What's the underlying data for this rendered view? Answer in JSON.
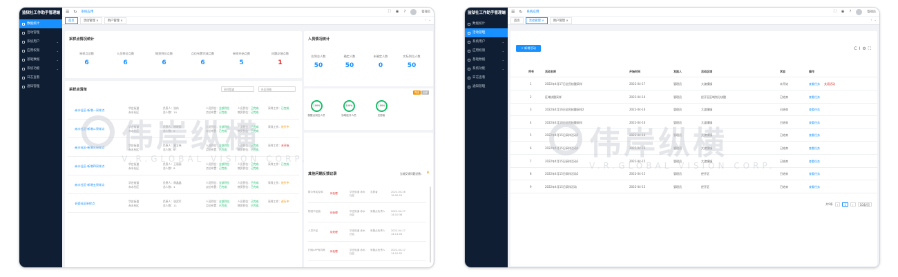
{
  "brand": "监狱社工作助手管理端",
  "watermark": {
    "cn": "伟岸纵横",
    "en": "V.R.GLOBAL VISION CORP."
  },
  "left": {
    "menu": [
      "数据统计",
      "活动管理",
      "系统用户",
      "应用权限",
      "基础数据",
      "系统功能",
      "日志查看",
      "通知管理"
    ],
    "active_index": 0,
    "topbar": {
      "breadcrumb": "系统应用",
      "user": "管理员"
    },
    "tabs": [
      "首页",
      "活动管理 ×",
      "用户管理 ×"
    ],
    "samples": {
      "title": "采样点情况统计",
      "stats": [
        {
          "label": "采样点总数",
          "value": "6"
        },
        {
          "label": "人员到位点数",
          "value": "6"
        },
        {
          "label": "物资到位点数",
          "value": "6"
        },
        {
          "label": "点位布置完成点数",
          "value": "6"
        },
        {
          "label": "采样开始点数",
          "value": "5"
        },
        {
          "label": "问题反馈点数",
          "value": "1"
        }
      ]
    },
    "people": {
      "title": "人员情况统计",
      "stats": [
        {
          "label": "应到总人数",
          "value": "50"
        },
        {
          "label": "确定人数",
          "value": "50"
        },
        {
          "label": "未确定人数",
          "value": "0"
        },
        {
          "label": "实际到位人数",
          "value": "50"
        }
      ],
      "rings": [
        {
          "pct": "100%",
          "label": "核酸点到位人员"
        },
        {
          "pct": "100%",
          "label": "协助医疗人员"
        },
        {
          "pct": "100%",
          "label": "志愿者"
        }
      ],
      "tags": [
        "筛选",
        "全部"
      ]
    },
    "list": {
      "title": "采样点清单",
      "filters": [
        "采样管道",
        "社区网格"
      ],
      "rows": [
        {
          "name": "赤水社区-新增一采样点",
          "street": "华庄街道",
          "community": "赤水社区",
          "leader": "负责人：张伟",
          "count": "总人数：10",
          "r1": "人员到位：",
          "s1": "全部到位",
          "r2": "人员到位：",
          "s2": "已完成",
          "r3": "点位布置：",
          "s3": "已完成",
          "r4": "物资到位：",
          "s4": "已完成",
          "w": "采样工作：",
          "ws": "已完成",
          "wc": "g"
        },
        {
          "name": "赤水社区-新增二采样点",
          "street": "华庄街道",
          "community": "赤水社区",
          "leader": "负责人：杨晓雨",
          "count": "总人数：8",
          "r1": "人员到位：",
          "s1": "全部到位",
          "r2": "人员到位：",
          "s2": "已完成",
          "r3": "点位布置：",
          "s3": "已完成",
          "r4": "物资到位：",
          "s4": "已完成",
          "w": "采样工作：",
          "ws": "进行中",
          "wc": "or"
        },
        {
          "name": "赤水社区-新增三采样点",
          "street": "华庄街道",
          "community": "赤水社区",
          "leader": "负责人：黄立伟",
          "count": "总人数：6",
          "r1": "人员到位：",
          "s1": "全部到位",
          "r2": "人员到位：",
          "s2": "已完成",
          "r3": "点位布置：",
          "s3": "已完成",
          "r4": "物资到位：",
          "s4": "已完成",
          "w": "采样工作：",
          "ws": "未开始",
          "wc": "rd"
        },
        {
          "name": "赤水社区-新增四采样点",
          "street": "华庄街道",
          "community": "赤水社区",
          "leader": "负责人：王丽丽",
          "count": "总人数：8",
          "r1": "人员到位：",
          "s1": "全部到位",
          "r2": "人员到位：",
          "s2": "已完成",
          "r3": "点位布置：",
          "s3": "已完成",
          "r4": "物资到位：",
          "s4": "已完成",
          "w": "采样工作：",
          "ws": "已完成",
          "wc": "g"
        },
        {
          "name": "赤水社区-新增五采样点",
          "street": "华庄街道",
          "community": "赤水社区",
          "leader": "负责人：周晶晶",
          "count": "总人数：4",
          "r1": "人员到位：",
          "s1": "全部到位",
          "r2": "人员到位：",
          "s2": "已完成",
          "r3": "点位布置：",
          "s3": "已完成",
          "r4": "物资到位：",
          "s4": "已完成",
          "w": "采样工作：",
          "ws": "进行中",
          "wc": "or"
        },
        {
          "name": "长德社区采样点",
          "street": "华庄街道",
          "community": "赤水社区",
          "leader": "负责人：张武军",
          "count": "总人数：11",
          "r1": "人员到位：",
          "s1": "全部到位",
          "r2": "人员到位：",
          "s2": "已完成",
          "r3": "点位布置：",
          "s3": "已完成",
          "r4": "物资到位：",
          "s4": "已完成",
          "w": "采样工作：",
          "ws": "进行中",
          "wc": "or"
        }
      ]
    },
    "issues": {
      "title": "其他问题反馈记录",
      "extra": "当前反馈问题总数：",
      "count": "4",
      "rows": [
        {
          "type": "群众有民反映",
          "status": "待处理",
          "place": "华庄街道 赤水社区",
          "who": "志愿者",
          "time": "2022-04-16 16:50:29"
        },
        {
          "type": "物资不足缺",
          "status": "待处理",
          "place": "华庄街道 赤水社区",
          "who": "采集点负责人",
          "time": "2022-04-17 14:10:36"
        },
        {
          "type": "人员不足",
          "status": "待处理",
          "place": "华庄街道 赤水社区",
          "who": "采集点负责人",
          "time": "2022-04-17 14:11:03"
        },
        {
          "type": "扫码APP有异常",
          "status": "待处理",
          "place": "华庄街道 赤水社区",
          "who": "采集点负责人",
          "time": "2022-04-17 14:10:52"
        }
      ]
    }
  },
  "right": {
    "menu": [
      "数据统计",
      "活动管理",
      "系统用户",
      "应用权限",
      "基础数据",
      "系统功能",
      "日志查看",
      "通知管理"
    ],
    "active_index": 1,
    "topbar": {
      "breadcrumb": "系统应用",
      "user": "管理员"
    },
    "tabs": [
      "首页",
      "活动管理 ×",
      "用户管理 ×"
    ],
    "new_button": "+ 新增活动",
    "columns": [
      "序号",
      "活动名称",
      "开始时间",
      "发起人",
      "活动区域",
      "状态",
      "操作"
    ],
    "rows": [
      {
        "no": "1",
        "name": "2022年4月17日全民核酸采样",
        "start": "2022-04-17",
        "by": "管理员",
        "area": "大渡镇镇",
        "status": "未开始",
        "ops": "查看任务",
        "ops2": "关闭活动"
      },
      {
        "no": "2",
        "name": "区域核酸采样",
        "start": "2022-04-16",
        "by": "管理员",
        "area": "经开区区域划分核酸",
        "status": "已结束",
        "ops": "查看任务",
        "ops2": ""
      },
      {
        "no": "3",
        "name": "2022年4月16日全民核酸采样2",
        "start": "2022-04-16",
        "by": "管理员",
        "area": "大渡镇镇",
        "status": "已结束",
        "ops": "查看任务",
        "ops2": ""
      },
      {
        "no": "4",
        "name": "2022年4月16日全民核酸采样",
        "start": "2022-04-16",
        "by": "管理员",
        "area": "大渡镇镇",
        "status": "已结束",
        "ops": "查看任务",
        "ops2": ""
      },
      {
        "no": "5",
        "name": "2022年4月15日采样活动5",
        "start": "2022-04-16",
        "by": "管理员",
        "area": "大渡镇镇",
        "status": "已结束",
        "ops": "查看任务",
        "ops2": ""
      },
      {
        "no": "6",
        "name": "2022年4月15日采样活动4",
        "start": "2022-04-16",
        "by": "管理员",
        "area": "大渡镇镇",
        "status": "已结束",
        "ops": "查看任务",
        "ops2": ""
      },
      {
        "no": "7",
        "name": "2022年4月15日采样活动3",
        "start": "2022-04-15",
        "by": "管理员",
        "area": "大渡镇镇",
        "status": "已结束",
        "ops": "查看任务",
        "ops2": ""
      },
      {
        "no": "8",
        "name": "2022年4月15日采样活动2",
        "start": "2022-04-15",
        "by": "管理员",
        "area": "经开区",
        "status": "已结束",
        "ops": "查看任务",
        "ops2": ""
      },
      {
        "no": "9",
        "name": "2022年4月15日采样活动",
        "start": "2022-04-15",
        "by": "管理员",
        "area": "经开区",
        "status": "已结束",
        "ops": "查看任务",
        "ops2": ""
      }
    ],
    "pager": {
      "total": "共9条",
      "page": "1",
      "size": "10条/页"
    }
  }
}
